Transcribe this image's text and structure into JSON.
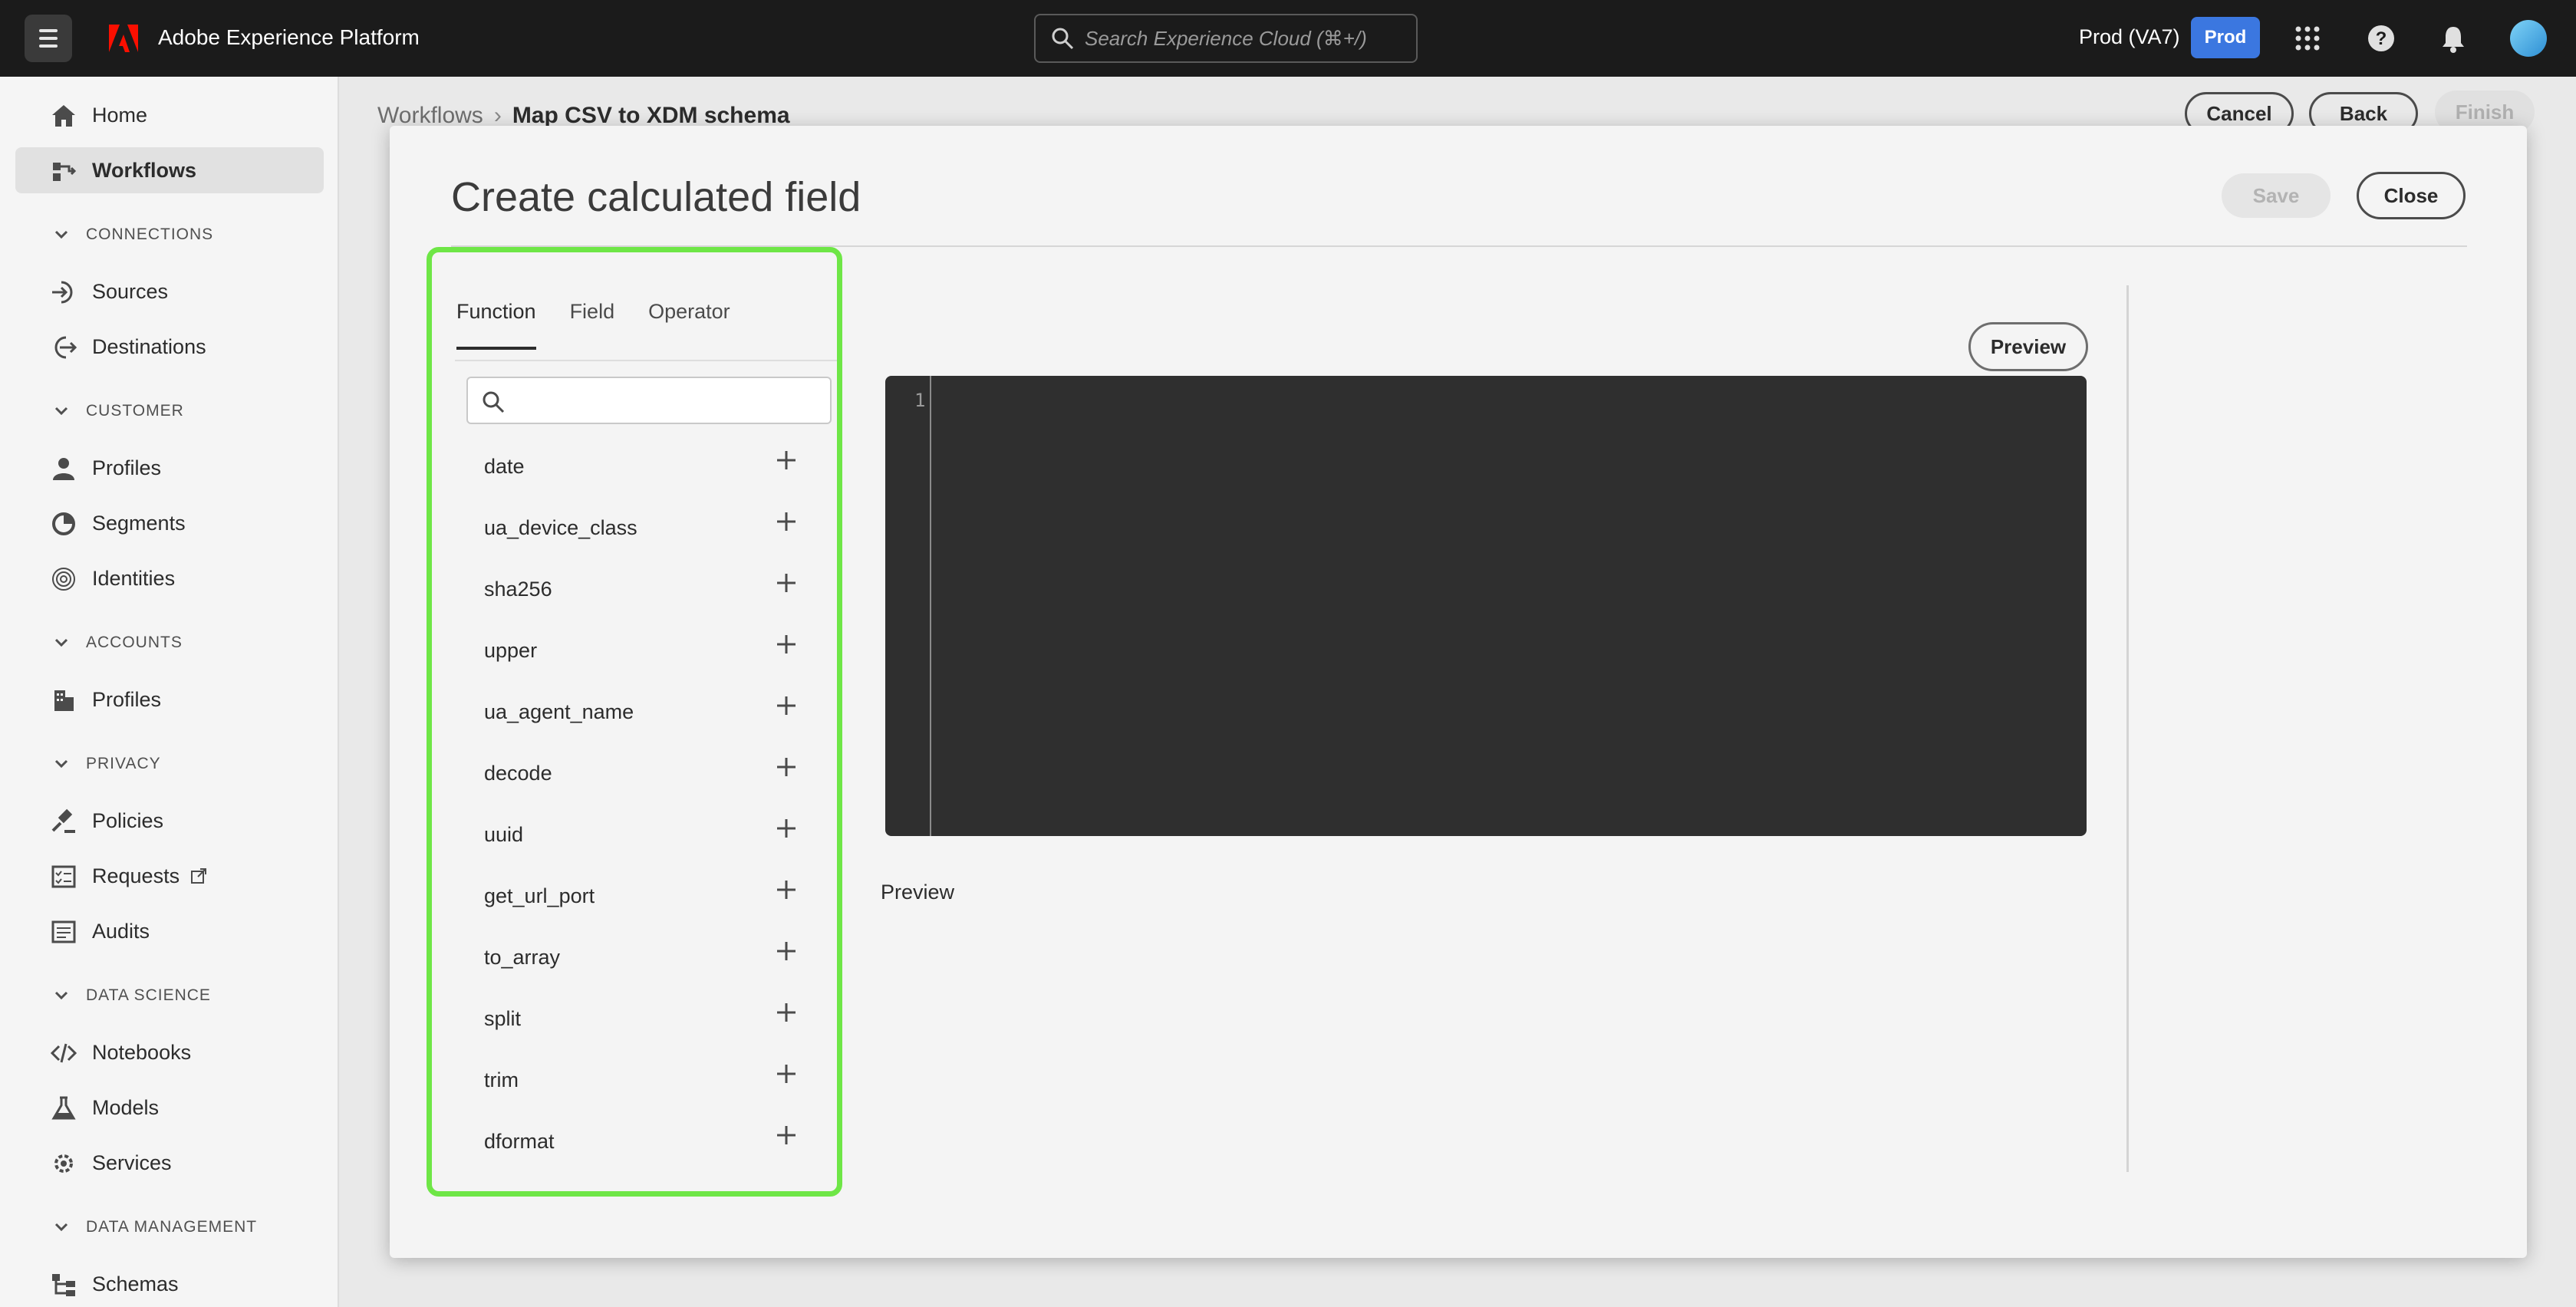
{
  "topbar": {
    "app_title": "Adobe Experience Platform",
    "search_placeholder": "Search Experience Cloud (⌘+/)",
    "org_name": "Prod (VA7)",
    "sandbox_badge": "Prod"
  },
  "sidebar": {
    "items": {
      "home": "Home",
      "workflows": "Workflows",
      "sources": "Sources",
      "destinations": "Destinations",
      "customer_profiles": "Profiles",
      "segments": "Segments",
      "identities": "Identities",
      "account_profiles": "Profiles",
      "policies": "Policies",
      "requests": "Requests",
      "audits": "Audits",
      "notebooks": "Notebooks",
      "models": "Models",
      "services": "Services",
      "schemas": "Schemas"
    },
    "sections": {
      "connections": "CONNECTIONS",
      "customer": "CUSTOMER",
      "accounts": "ACCOUNTS",
      "privacy": "PRIVACY",
      "data_science": "DATA SCIENCE",
      "data_management": "DATA MANAGEMENT"
    }
  },
  "page": {
    "breadcrumb_root": "Workflows",
    "breadcrumb_current": "Map CSV to XDM schema",
    "cancel_label": "Cancel",
    "back_label": "Back",
    "finish_label": "Finish"
  },
  "modal": {
    "title": "Create calculated field",
    "save_label": "Save",
    "close_label": "Close",
    "tabs": [
      "Function",
      "Field",
      "Operator"
    ],
    "functions": [
      "date",
      "ua_device_class",
      "sha256",
      "upper",
      "ua_agent_name",
      "decode",
      "uuid",
      "get_url_port",
      "to_array",
      "split",
      "trim",
      "dformat"
    ],
    "preview_button": "Preview",
    "editor_line_number": "1",
    "preview_label": "Preview"
  },
  "colors": {
    "highlight": "#6ee646",
    "prod_badge": "#3b77e0",
    "topbar": "#1b1b1b",
    "editor_bg": "#2f2f2f"
  }
}
